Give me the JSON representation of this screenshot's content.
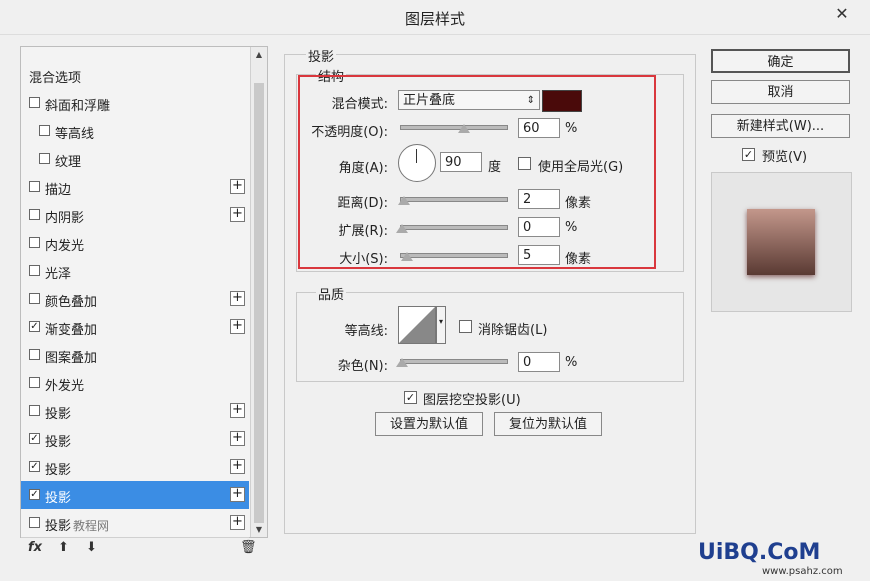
{
  "window": {
    "title": "图层样式",
    "close": "✕"
  },
  "left_list": {
    "items": [
      {
        "label": "混合选项",
        "checkbox": false,
        "checked": false,
        "plus": false,
        "indent": 0
      },
      {
        "label": "斜面和浮雕",
        "checkbox": true,
        "checked": false,
        "plus": false,
        "indent": 0
      },
      {
        "label": "等高线",
        "checkbox": true,
        "checked": false,
        "plus": false,
        "indent": 1
      },
      {
        "label": "纹理",
        "checkbox": true,
        "checked": false,
        "plus": false,
        "indent": 1
      },
      {
        "label": "描边",
        "checkbox": true,
        "checked": false,
        "plus": true,
        "indent": 0
      },
      {
        "label": "内阴影",
        "checkbox": true,
        "checked": false,
        "plus": true,
        "indent": 0
      },
      {
        "label": "内发光",
        "checkbox": true,
        "checked": false,
        "plus": false,
        "indent": 0
      },
      {
        "label": "光泽",
        "checkbox": true,
        "checked": false,
        "plus": false,
        "indent": 0
      },
      {
        "label": "颜色叠加",
        "checkbox": true,
        "checked": false,
        "plus": true,
        "indent": 0
      },
      {
        "label": "渐变叠加",
        "checkbox": true,
        "checked": true,
        "plus": true,
        "indent": 0
      },
      {
        "label": "图案叠加",
        "checkbox": true,
        "checked": false,
        "plus": false,
        "indent": 0
      },
      {
        "label": "外发光",
        "checkbox": true,
        "checked": false,
        "plus": false,
        "indent": 0
      },
      {
        "label": "投影",
        "checkbox": true,
        "checked": false,
        "plus": true,
        "indent": 0
      },
      {
        "label": "投影",
        "checkbox": true,
        "checked": true,
        "plus": true,
        "indent": 0
      },
      {
        "label": "投影",
        "checkbox": true,
        "checked": true,
        "plus": true,
        "indent": 0
      },
      {
        "label": "投影",
        "checkbox": true,
        "checked": true,
        "plus": true,
        "indent": 0,
        "selected": true
      },
      {
        "label": "投影",
        "checkbox": true,
        "checked": false,
        "plus": true,
        "indent": 0
      }
    ],
    "watermark": "教程网"
  },
  "bottom_icons": {
    "fx": "fx",
    "up": "⬆",
    "down": "⬇",
    "trash": "🗑"
  },
  "drop_shadow": {
    "title": "投影",
    "structure_title": "结构",
    "blend_mode_label": "混合模式:",
    "blend_mode_value": "正片叠底",
    "shadow_color": "#4a0a0a",
    "opacity_label": "不透明度(O):",
    "opacity_value": "60",
    "opacity_unit": "%",
    "opacity_level": 0.6,
    "angle_label": "角度(A):",
    "angle_value": "90",
    "angle_unit": "度",
    "global_light_label": "使用全局光(G)",
    "global_light_checked": false,
    "distance_label": "距离(D):",
    "distance_value": "2",
    "distance_unit": "像素",
    "spread_label": "扩展(R):",
    "spread_value": "0",
    "spread_unit": "%",
    "size_label": "大小(S):",
    "size_value": "5",
    "size_unit": "像素",
    "quality_title": "品质",
    "contour_label": "等高线:",
    "antialias_label": "消除锯齿(L)",
    "antialias_checked": false,
    "noise_label": "杂色(N):",
    "noise_value": "0",
    "noise_unit": "%",
    "knockout_label": "图层挖空投影(U)",
    "knockout_checked": true,
    "make_default": "设置为默认值",
    "reset_default": "复位为默认值"
  },
  "right": {
    "ok": "确定",
    "cancel": "取消",
    "new_style": "新建样式(W)...",
    "preview_label": "预览(V)",
    "preview_checked": true
  },
  "footer_watermark": {
    "logo": "UiBQ.CoM",
    "url": "www.psahz.com"
  }
}
